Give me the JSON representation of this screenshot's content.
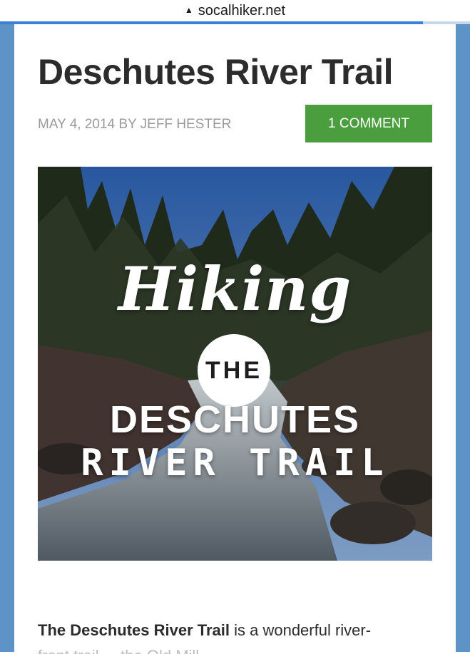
{
  "browser": {
    "lock_icon": "lock-icon",
    "url": "socalhiker.net"
  },
  "post": {
    "title": "Deschutes River Trail",
    "meta": "MAY 4, 2014 BY JEFF HESTER",
    "comment_button": "1 COMMENT",
    "hero": {
      "script_word": "Hiking",
      "circle_word": "THE",
      "line1": "DESCHUTES",
      "line2": "RIVER TRAIL"
    },
    "intro_bold": "The Deschutes River Trail",
    "intro_rest": " is a wonderful river-",
    "intro_next": "front trail ... the Old Mill"
  },
  "colors": {
    "accent_green": "#4b9e3d",
    "frame_blue": "#5d93c6",
    "load_blue": "#3c7fd9"
  }
}
